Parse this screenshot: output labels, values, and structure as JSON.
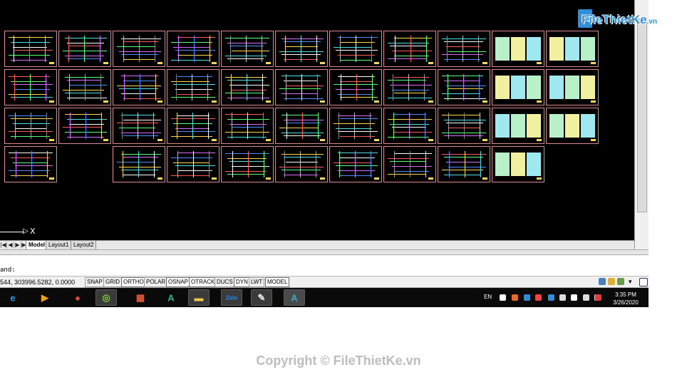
{
  "logo": {
    "brand": "FileThietKe",
    "tld": ".vn"
  },
  "watermark": "Copyright © FileThietKe.vn",
  "canvas": {
    "background": "#000000",
    "sheet_border_color": "#d98a8a"
  },
  "ucs_icon": {
    "x_label": "X"
  },
  "layout_tabs": {
    "nav": [
      "|◀",
      "◀",
      "▶",
      "▶|"
    ],
    "tabs": [
      {
        "label": "Model",
        "active": true
      },
      {
        "label": "Layout1",
        "active": false
      },
      {
        "label": "Layout2",
        "active": false
      }
    ]
  },
  "command": {
    "line": "and:"
  },
  "status_bar": {
    "coordinates": "544, 303996.5282, 0.0000",
    "toggles": [
      {
        "label": "SNAP",
        "on": false
      },
      {
        "label": "GRID",
        "on": false
      },
      {
        "label": "ORTHO",
        "on": true
      },
      {
        "label": "POLAR",
        "on": false
      },
      {
        "label": "OSNAP",
        "on": true
      },
      {
        "label": "OTRACK",
        "on": true
      },
      {
        "label": "DUCS",
        "on": false
      },
      {
        "label": "DYN",
        "on": true
      },
      {
        "label": "LWT",
        "on": false
      },
      {
        "label": "MODEL",
        "on": true
      }
    ]
  },
  "taskbar": {
    "apps": [
      {
        "name": "internet-explorer-icon",
        "glyph": "e",
        "color": "#2a9be0"
      },
      {
        "name": "media-player-icon",
        "glyph": "▶",
        "color": "#e8a020"
      },
      {
        "name": "chrome-icon",
        "glyph": "●",
        "color": "#e04a3a"
      },
      {
        "name": "coccoc-icon",
        "glyph": "◎",
        "color": "#7ccc3a"
      },
      {
        "name": "windows-app-icon",
        "glyph": "▦",
        "color": "#e05a3a"
      },
      {
        "name": "app-store-icon",
        "glyph": "A",
        "color": "#2ab38a"
      },
      {
        "name": "file-explorer-icon",
        "glyph": "▬",
        "color": "#f2c94c"
      },
      {
        "name": "zalo-icon",
        "glyph": "Zalo",
        "color": "#1a8cff"
      },
      {
        "name": "paint-icon",
        "glyph": "✎",
        "color": "#e6e6e6"
      },
      {
        "name": "autocad-icon",
        "glyph": "A",
        "color": "#3fa9c9"
      }
    ],
    "language": "EN",
    "tray": [
      {
        "name": "cloud-icon",
        "color": "#ffffff"
      },
      {
        "name": "shield-icon",
        "color": "#e86a2a"
      },
      {
        "name": "chat-icon",
        "color": "#2a8ce0"
      },
      {
        "name": "speaker-icon",
        "color": "#ff4040"
      },
      {
        "name": "network-icon",
        "color": "#2a8ce0"
      },
      {
        "name": "display-icon",
        "color": "#dddddd"
      },
      {
        "name": "flag-icon",
        "color": "#ffffff"
      },
      {
        "name": "battery-icon",
        "color": "#dddddd"
      },
      {
        "name": "volume-icon",
        "color": "#dddddd"
      },
      {
        "name": "antivirus-icon",
        "color": "#e03a3a"
      }
    ],
    "time": "3:35 PM",
    "date": "3/26/2020"
  }
}
